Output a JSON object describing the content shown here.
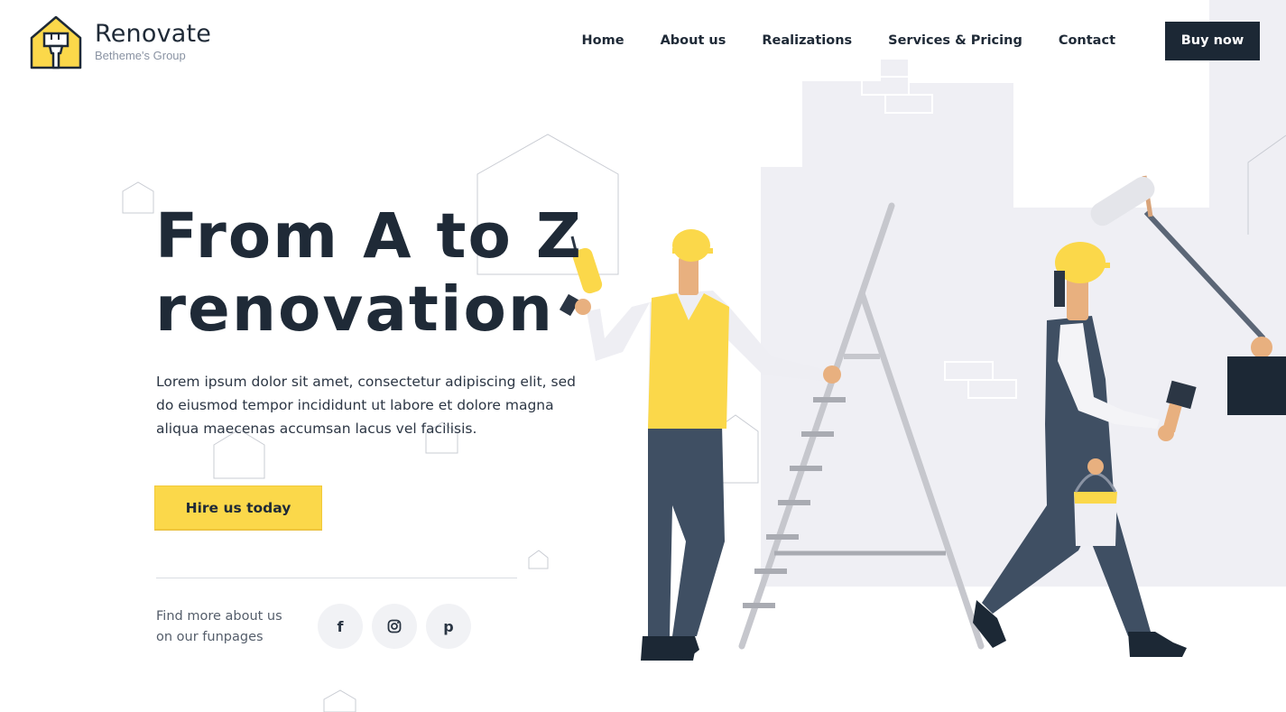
{
  "brand": {
    "name": "Renovate",
    "subtitle": "Betheme's Group",
    "logo_icon": "house-paintbrush-icon",
    "accent_color": "#fbd84a",
    "dark_color": "#1c2835"
  },
  "nav": {
    "items": [
      {
        "label": "Home"
      },
      {
        "label": "About us"
      },
      {
        "label": "Realizations"
      },
      {
        "label": "Services & Pricing"
      },
      {
        "label": "Contact"
      }
    ],
    "cta_label": "Buy now"
  },
  "hero": {
    "title_line1": "From A to Z",
    "title_line2": "renovation",
    "body": "Lorem ipsum dolor sit amet, consectetur adipiscing elit, sed do eiusmod tempor incididunt ut labore et dolore magna aliqua maecenas accumsan lacus vel facilisis.",
    "cta_label": "Hire us today"
  },
  "social": {
    "label_line1": "Find more about us",
    "label_line2": "on our funpages",
    "icons": [
      {
        "name": "facebook-icon",
        "glyph": "f"
      },
      {
        "name": "instagram-icon",
        "glyph": "◎"
      },
      {
        "name": "pinterest-icon",
        "glyph": "p"
      }
    ]
  }
}
